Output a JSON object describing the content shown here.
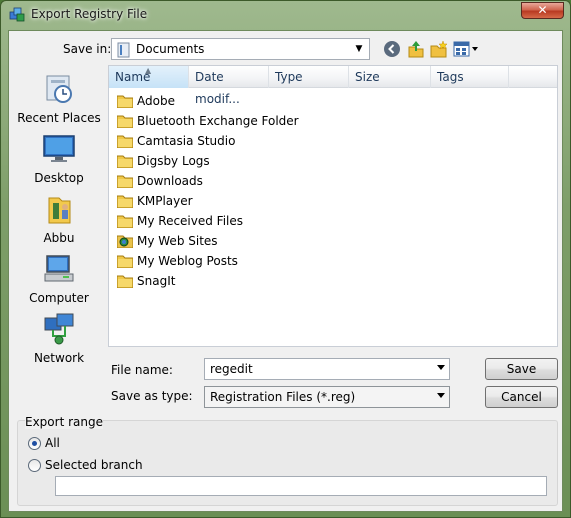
{
  "window": {
    "title": "Export Registry File",
    "close_label": "✕"
  },
  "header": {
    "save_in_label": "Save in:",
    "location": "Documents"
  },
  "places": [
    {
      "label": "Recent Places",
      "icon": "recent-places-icon"
    },
    {
      "label": "Desktop",
      "icon": "desktop-icon"
    },
    {
      "label": "Abbu",
      "icon": "user-folder-icon"
    },
    {
      "label": "Computer",
      "icon": "computer-icon"
    },
    {
      "label": "Network",
      "icon": "network-icon"
    }
  ],
  "filelist": {
    "columns": [
      "Name",
      "Date modif...",
      "Type",
      "Size",
      "Tags"
    ],
    "items": [
      {
        "name": "Adobe",
        "icon": "folder-icon"
      },
      {
        "name": "Bluetooth Exchange Folder",
        "icon": "folder-icon"
      },
      {
        "name": "Camtasia Studio",
        "icon": "folder-icon"
      },
      {
        "name": "Digsby Logs",
        "icon": "folder-icon"
      },
      {
        "name": "Downloads",
        "icon": "folder-icon"
      },
      {
        "name": "KMPlayer",
        "icon": "folder-icon"
      },
      {
        "name": "My Received Files",
        "icon": "folder-icon"
      },
      {
        "name": "My Web Sites",
        "icon": "web-folder-icon"
      },
      {
        "name": "My Weblog Posts",
        "icon": "folder-icon"
      },
      {
        "name": "SnagIt",
        "icon": "folder-icon"
      }
    ]
  },
  "form": {
    "file_name_label": "File name:",
    "file_name_value": "regedit",
    "save_as_type_label": "Save as type:",
    "save_as_type_value": "Registration Files (*.reg)",
    "save_button": "Save",
    "cancel_button": "Cancel"
  },
  "export_range": {
    "title": "Export range",
    "all_label": "All",
    "branch_label": "Selected branch",
    "selected": "All",
    "branch_value": ""
  }
}
